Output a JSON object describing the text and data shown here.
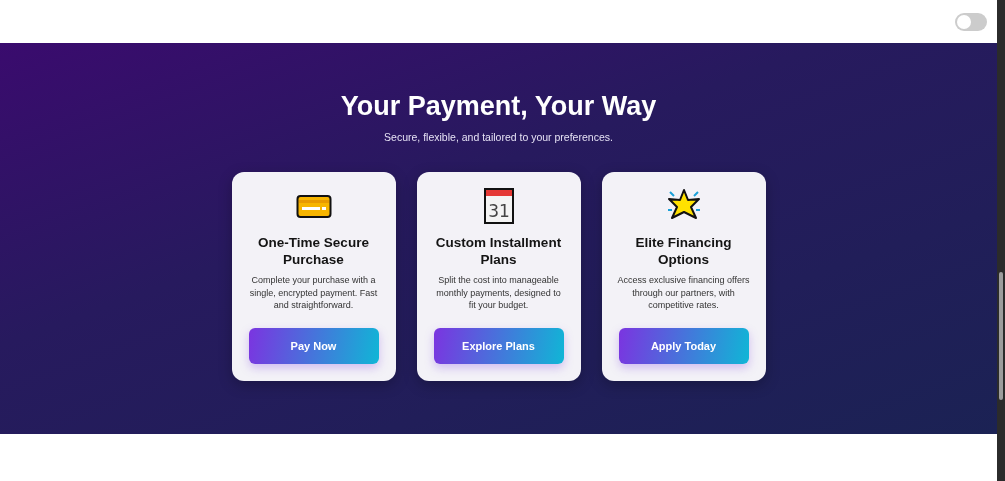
{
  "header": {
    "toggle": {
      "on": false
    }
  },
  "hero": {
    "title": "Your Payment, Your Way",
    "subtitle": "Secure, flexible, and tailored to your preferences.",
    "cards": [
      {
        "kind": "card",
        "title": "One-Time Secure Purchase",
        "description": "Complete your purchase with a single, encrypted payment. Fast and straightforward.",
        "button": "Pay Now"
      },
      {
        "kind": "calendar",
        "icon_text": "31",
        "title": "Custom Installment Plans",
        "description": "Split the cost into manageable monthly payments, designed to fit your budget.",
        "button": "Explore Plans"
      },
      {
        "kind": "star",
        "title": "Elite Financing Options",
        "description": "Access exclusive financing offers through our partners, with competitive rates.",
        "button": "Apply Today"
      }
    ]
  }
}
